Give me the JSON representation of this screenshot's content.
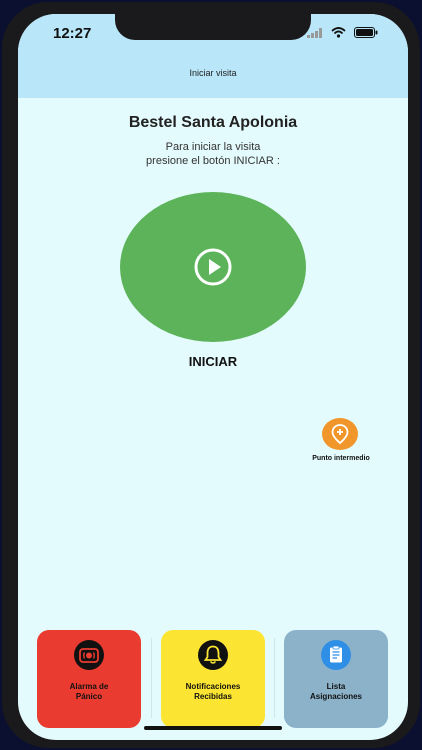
{
  "status_bar": {
    "time": "12:27"
  },
  "nav": {
    "title": "Iniciar visita"
  },
  "main": {
    "place_name": "Bestel Santa Apolonia",
    "instruction_line1": "Para iniciar la visita",
    "instruction_line2": "presione el botón INICIAR :",
    "start_label": "INICIAR",
    "waypoint_label": "Punto intermedio"
  },
  "tiles": [
    {
      "line1": "Alarma de",
      "line2": "Pánico",
      "color": "#ea3b30",
      "icon": "alarm-icon"
    },
    {
      "line1": "Notificaciones",
      "line2": "Recibidas",
      "color": "#fbe532",
      "icon": "bell-icon"
    },
    {
      "line1": "Lista",
      "line2": "Asignaciones",
      "color": "#8bb2c9",
      "icon": "clipboard-icon"
    }
  ],
  "colors": {
    "start": "#5cb35a",
    "waypoint": "#f0962a",
    "topbar": "#b9e6f8",
    "background": "#e4fbfd"
  }
}
